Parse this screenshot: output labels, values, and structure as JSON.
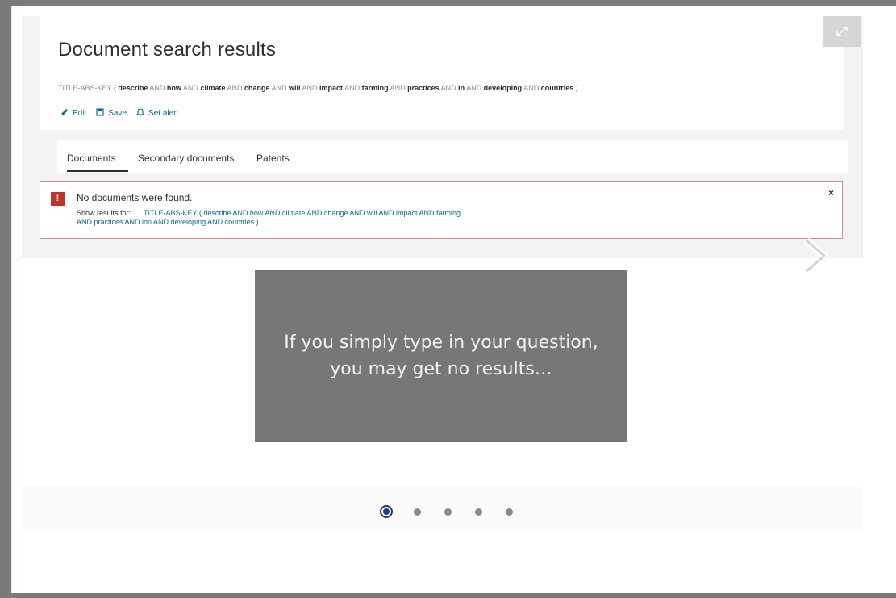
{
  "header": {
    "title": "Document search results",
    "query": {
      "prefix": "TITLE-ABS-KEY (",
      "terms": [
        "describe",
        "how",
        "climate",
        "change",
        "will",
        "impact",
        "farming",
        "practices",
        "in",
        "developing",
        "countries"
      ],
      "operator": "AND",
      "suffix": ")"
    },
    "actions": {
      "edit": "Edit",
      "save": "Save",
      "alert": "Set alert"
    }
  },
  "tabs": [
    "Documents",
    "Secondary documents",
    "Patents"
  ],
  "alert": {
    "title": "No documents were found.",
    "prefix": "Show results for:",
    "suggestion_line1": "TITLE-ABS-KEY ( describe  AND how  AND climate  AND change  AND will  AND impact  AND farming",
    "suggestion_line2": "AND practices  AND ion  AND developing  AND countries )",
    "close": "×"
  },
  "slide": {
    "line1": "If you simply type in your question,",
    "line2": "you may get no results…"
  },
  "pagination": {
    "total": 5,
    "current": 1
  },
  "colors": {
    "link": "#006e8f",
    "alert_red": "#c5312a",
    "active_dot": "#1d3f8a"
  }
}
